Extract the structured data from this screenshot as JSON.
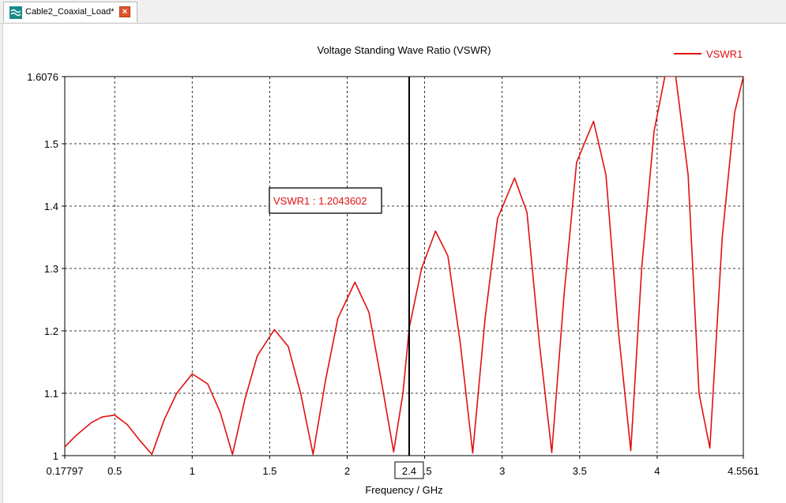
{
  "tab": {
    "title": "Cable2_Coaxial_Load*",
    "icon": "waveform-icon",
    "close_icon": "close-icon",
    "accent_color": "#e2562b"
  },
  "chart_data": {
    "type": "line",
    "title": "Voltage Standing Wave Ratio (VSWR)",
    "xlabel": "Frequency / GHz",
    "ylabel": "",
    "xlim": [
      0.17797,
      4.5561
    ],
    "ylim": [
      1,
      1.6076
    ],
    "x_ticks": [
      "0.17797",
      "0.5",
      "1",
      "1.5",
      "2",
      "2.5",
      "3",
      "3.5",
      "4",
      "4.5561"
    ],
    "x_tick_values": [
      0.17797,
      0.5,
      1,
      1.5,
      2,
      2.5,
      3,
      3.5,
      4,
      4.5561
    ],
    "y_ticks": [
      "1",
      "1.1",
      "1.2",
      "1.3",
      "1.4",
      "1.5",
      "1.6076"
    ],
    "y_tick_values": [
      1,
      1.1,
      1.2,
      1.3,
      1.4,
      1.5,
      1.6076
    ],
    "grid": true,
    "legend_position": "top-right",
    "series": [
      {
        "name": "VSWR1",
        "color": "#e01010",
        "x": [
          0.178,
          0.25,
          0.35,
          0.42,
          0.5,
          0.58,
          0.66,
          0.74,
          0.82,
          0.9,
          1.0,
          1.1,
          1.18,
          1.26,
          1.34,
          1.42,
          1.53,
          1.62,
          1.7,
          1.78,
          1.86,
          1.94,
          2.05,
          2.14,
          2.22,
          2.3,
          2.36,
          2.4,
          2.48,
          2.57,
          2.65,
          2.73,
          2.81,
          2.89,
          2.97,
          3.08,
          3.16,
          3.24,
          3.32,
          3.4,
          3.48,
          3.59,
          3.67,
          3.75,
          3.83,
          3.9,
          3.98,
          4.05,
          4.12,
          4.2,
          4.27,
          4.34,
          4.42,
          4.5,
          4.556
        ],
        "y": [
          1.014,
          1.032,
          1.053,
          1.062,
          1.065,
          1.05,
          1.025,
          1.002,
          1.058,
          1.1,
          1.131,
          1.115,
          1.07,
          1.002,
          1.09,
          1.16,
          1.202,
          1.175,
          1.1,
          1.002,
          1.12,
          1.22,
          1.278,
          1.23,
          1.12,
          1.006,
          1.1,
          1.2044,
          1.3,
          1.36,
          1.32,
          1.18,
          1.004,
          1.22,
          1.38,
          1.445,
          1.39,
          1.18,
          1.005,
          1.26,
          1.47,
          1.536,
          1.45,
          1.2,
          1.008,
          1.3,
          1.52,
          1.608,
          1.608,
          1.45,
          1.1,
          1.012,
          1.35,
          1.55,
          1.6076
        ]
      }
    ],
    "marker": {
      "x": 2.4,
      "x_label": "2.4",
      "readout": "VSWR1 : 1.2043602",
      "value": 1.2043602
    }
  }
}
